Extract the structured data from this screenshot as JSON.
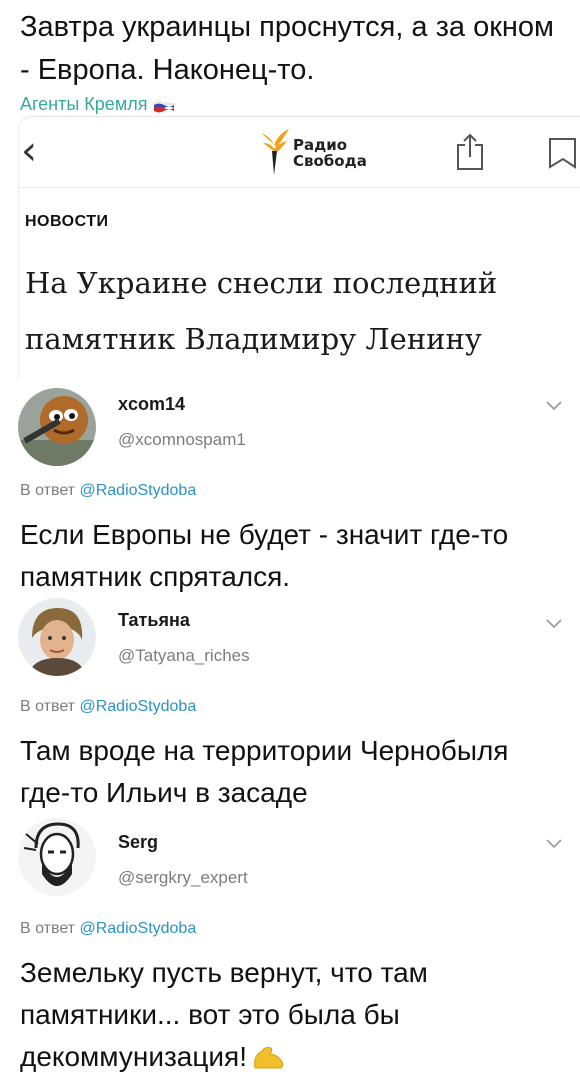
{
  "post": {
    "text": "Завтра украинцы проснутся, а за окном - Европа. Наконец-то.",
    "source": "Агенты Кремля"
  },
  "article": {
    "logo_line1": "Радио",
    "logo_line2": "Свобода",
    "section": "НОВОСТИ",
    "headline": "На Украине снесли последний памятник Владимиру Ленину"
  },
  "replies": [
    {
      "username": "xcom14",
      "handle": "@xcomnospam1",
      "in_reply_prefix": "В ответ",
      "mention": "@RadioStydoba",
      "text": "Если Европы не будет - значит где-то памятник спрятался."
    },
    {
      "username": "Татьяна",
      "handle": "@Tatyana_riches",
      "in_reply_prefix": "В ответ",
      "mention": "@RadioStydoba",
      "text": "Там вроде на территории Чернобыля где-то Ильич в засаде"
    },
    {
      "username": "Serg",
      "handle": "@sergkry_expert",
      "in_reply_prefix": "В ответ",
      "mention": "@RadioStydoba",
      "text": "Земельку пусть вернут, что там памятники... вот это была бы декоммунизация!"
    }
  ],
  "icons": {
    "back": "chevron-left-icon",
    "share": "share-icon",
    "bookmark": "bookmark-icon",
    "menu": "chevron-down-icon",
    "flag": "russian-flag-icon",
    "emoji": "flexed-biceps-icon"
  },
  "colors": {
    "source_link": "#35a8a0",
    "mention": "#2a93c8",
    "secondary_text": "#7d7d7d"
  }
}
